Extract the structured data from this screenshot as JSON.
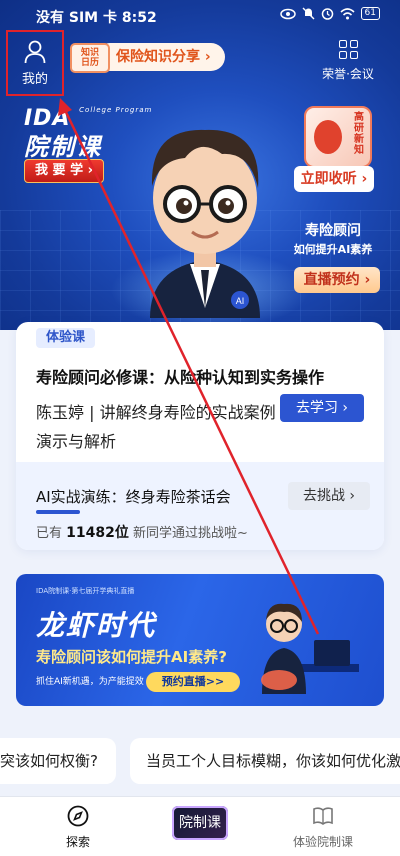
{
  "status_bar": {
    "carrier": "没有 SIM 卡",
    "time": "8:52",
    "battery": "61"
  },
  "header": {
    "my_label": "我的",
    "calendar_icon_text": [
      "知识",
      "日历"
    ],
    "share_pill": "保险知识分享 ›",
    "honor_label": "荣誉·会议"
  },
  "hero": {
    "ida_title": "IDA",
    "ida_subtitle": "College Program",
    "ida_program": "院制课",
    "learn_button": "我 要 学 ›",
    "book_text": "高研新知",
    "listen_button": "立即收听 ›",
    "advisor_title": "寿险顾问",
    "advisor_subtitle": "如何提升AI素养",
    "live_button": "直播预约 ›",
    "ai_badge": "AI"
  },
  "course_card": {
    "tag": "体验课",
    "title": "寿险顾问必修课：从险种认知到实务操作",
    "description": "陈玉婷 | 讲解终身寿险的实战案例演示与解析",
    "go_button": "去学习 ›",
    "challenge_title": "AI实战演练：终身寿险茶话会",
    "challenge_button": "去挑战 ›",
    "joined_prefix": "已有",
    "joined_count": "11482位",
    "joined_suffix": "新同学通过挑战啦~"
  },
  "banner": {
    "small_title": "IDA院制课·第七届开学典礼直播",
    "big_title": "龙虾时代",
    "question": "寿险顾问该如何提升AI素养?",
    "caption": "抓住AI新机遇，为产能提效",
    "book_button": "预约直播>>"
  },
  "topics": [
    "突该如何权衡?",
    "当员工个人目标模糊，你该如何优化激"
  ],
  "tabbar": {
    "explore": "探索",
    "center": "院制课",
    "experience": "体验院制课"
  },
  "colors": {
    "accent": "#2c55d1",
    "highlight": "#e0232b"
  }
}
